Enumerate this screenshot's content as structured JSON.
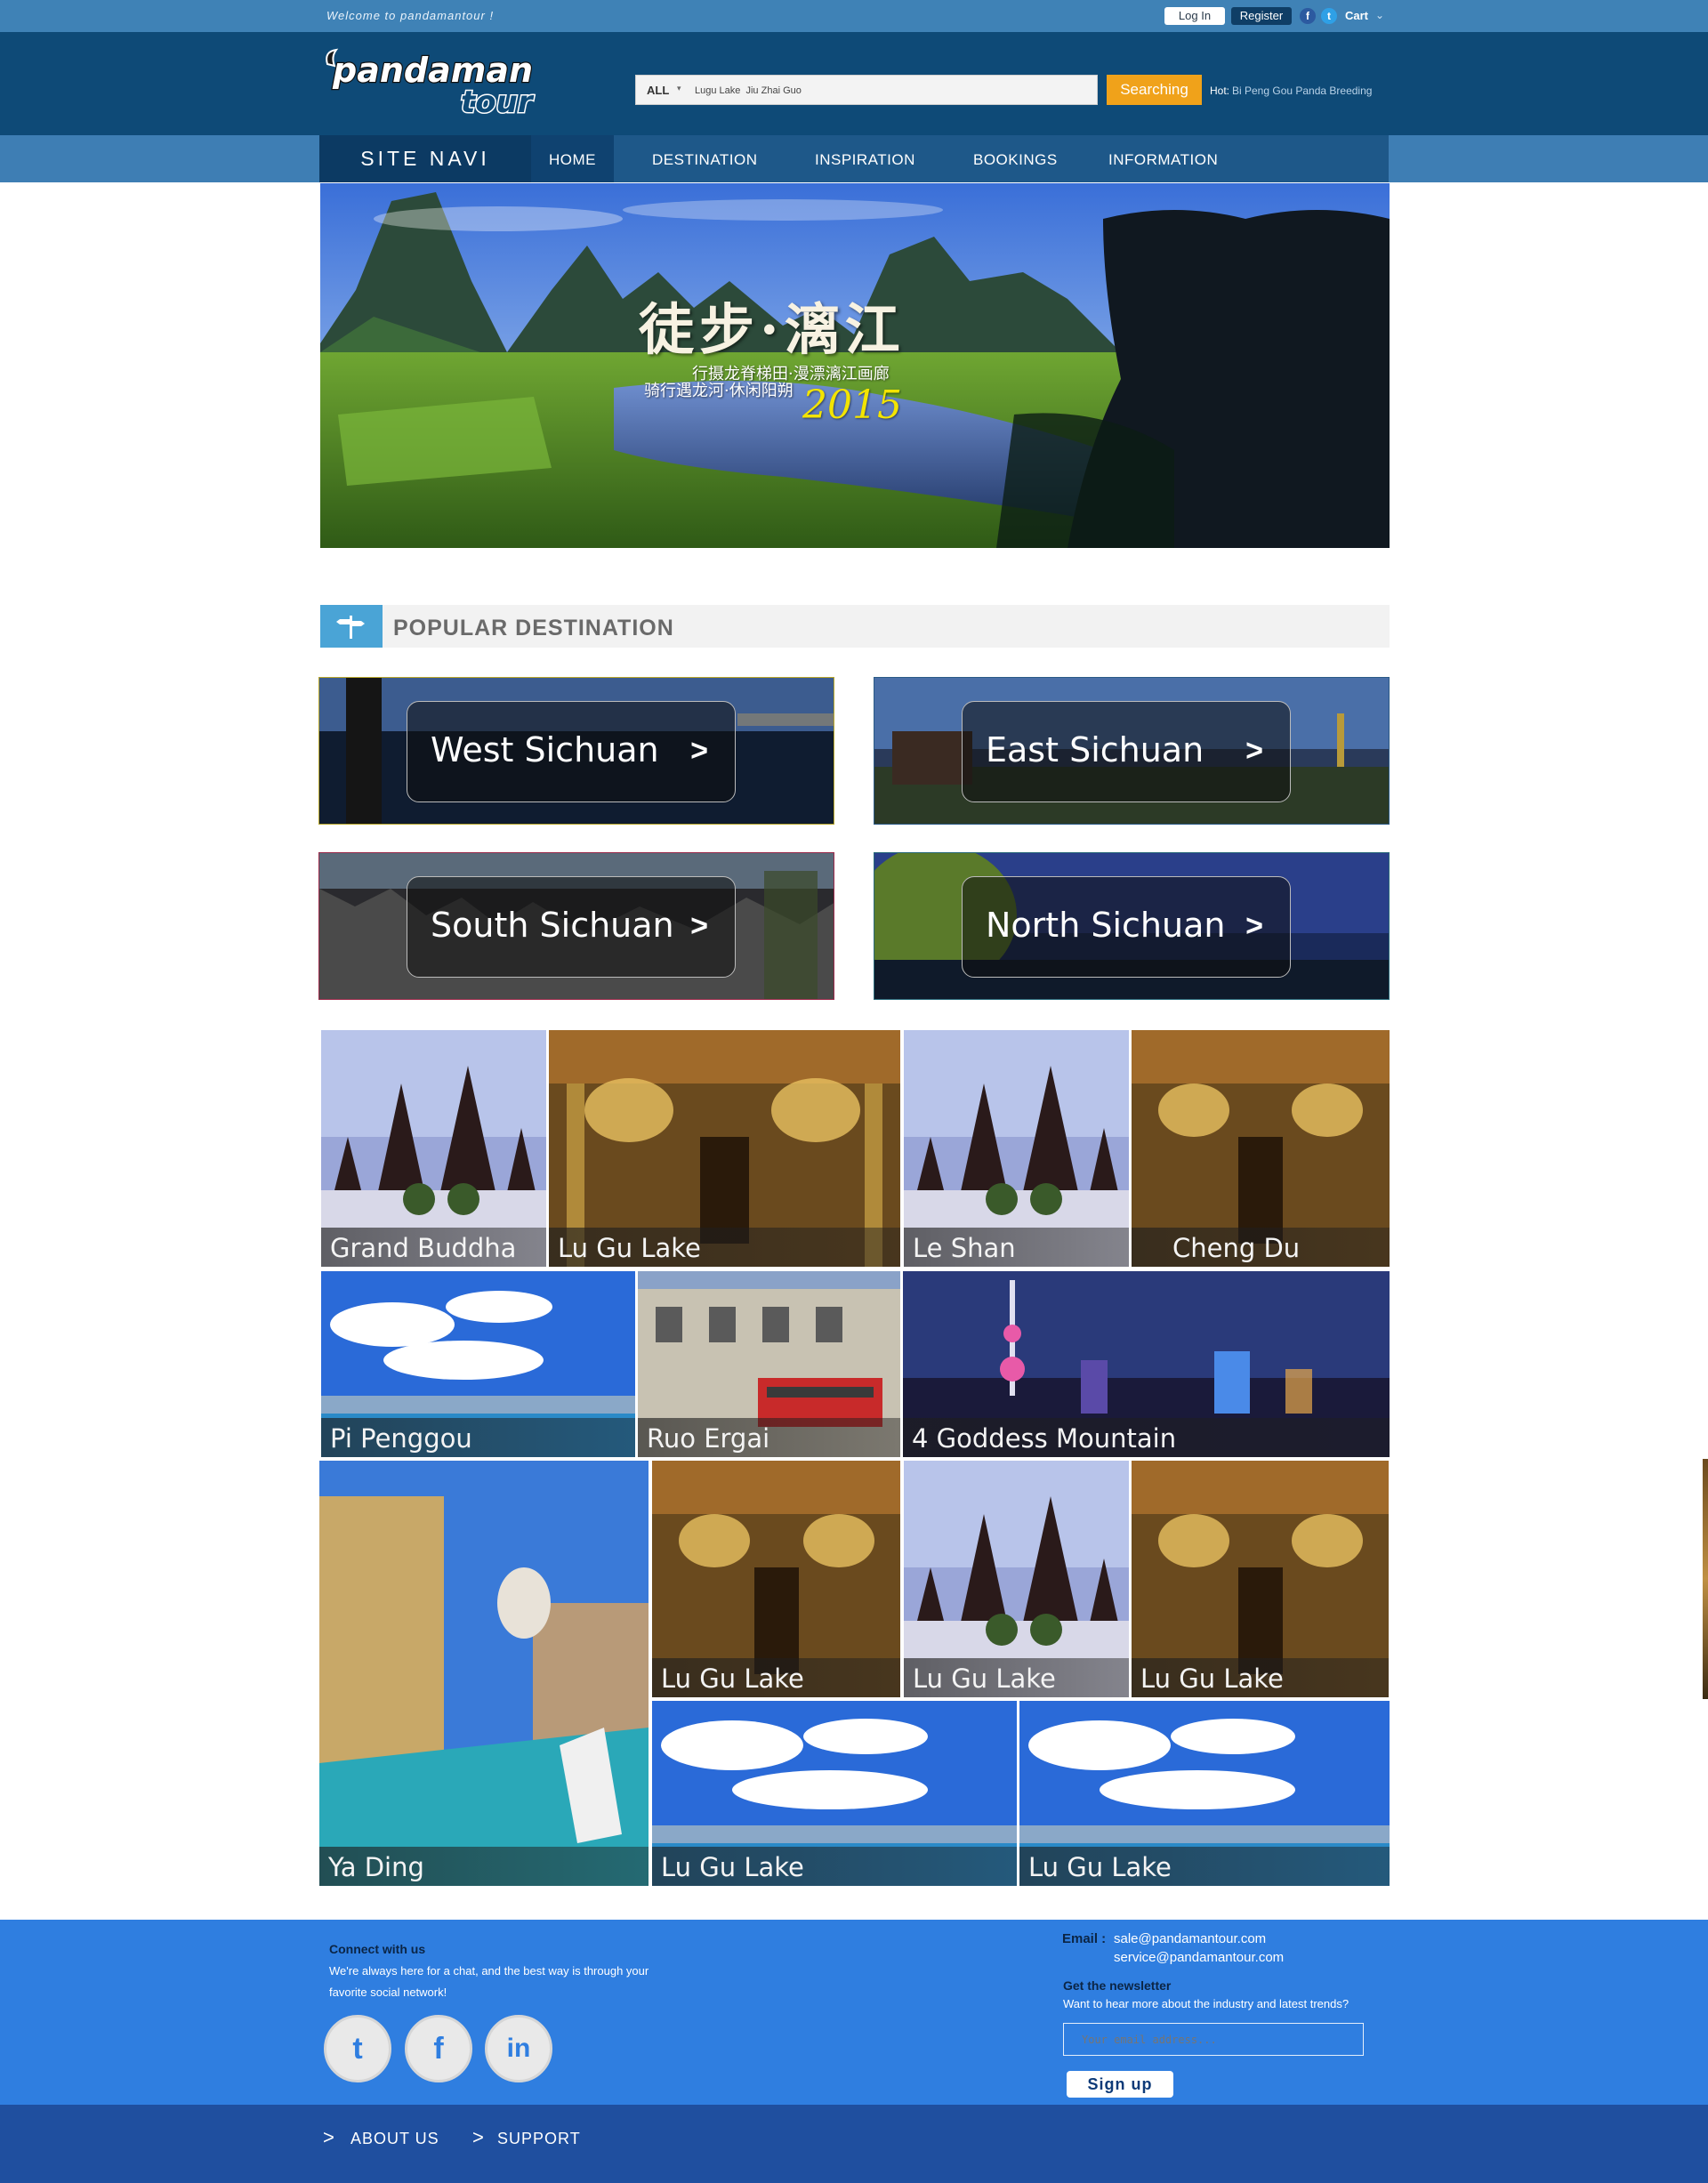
{
  "topbar": {
    "welcome": "Welcome  to  pandamantour !",
    "login": "Log In",
    "register": "Register",
    "facebook_glyph": "f",
    "twitter_glyph": "t",
    "cart": "Cart",
    "cart_chevron": "⌄"
  },
  "header": {
    "logo_line1": "pandaman",
    "logo_line2": "tour",
    "search": {
      "category": "ALL",
      "category_chevron": "▾",
      "value": "Lugu Lake  Jiu Zhai Guo",
      "button": "Searching"
    },
    "hot_label": "Hot:",
    "hot_links": "Bi Peng Gou  Panda Breeding"
  },
  "nav": {
    "site_navi": "SITE NAVI",
    "items": [
      "HOME",
      "DESTINATION",
      "INSPIRATION",
      "BOOKINGS",
      "INFORMATION"
    ]
  },
  "hero": {
    "title": "徒步·漓江",
    "subtitle1": "行摄龙脊梯田·漫漂漓江画廊",
    "subtitle2": "骑行遇龙河·休闲阳朔",
    "year": "2015"
  },
  "popular": {
    "title": "POPULAR DESTINATION",
    "regions": [
      {
        "name": "West Sichuan",
        "arrow": ">"
      },
      {
        "name": "East Sichuan",
        "arrow": ">"
      },
      {
        "name": "South Sichuan",
        "arrow": ">"
      },
      {
        "name": "North Sichuan",
        "arrow": ">"
      }
    ]
  },
  "gallery": {
    "tiles": [
      "Grand Buddha",
      "Lu Gu Lake",
      "Le Shan",
      "Cheng Du",
      "Pi Penggou",
      "Ruo Ergai",
      "4 Goddess Mountain",
      "Ya Ding",
      "Lu Gu Lake",
      "Lu Gu Lake",
      "Lu Gu Lake",
      "Lu Gu Lake",
      "Lu Gu Lake"
    ]
  },
  "footer": {
    "connect_title": "Connect with us",
    "connect_text": "We're always here for a chat, and the best way is through your  favorite social network!",
    "social_glyphs": [
      "t",
      "f",
      "in"
    ],
    "email_label": "Email :",
    "email1": "sale@pandamantour.com",
    "email2": "service@pandamantour.com",
    "newsletter_title": "Get the newsletter",
    "newsletter_text": "Want to hear more about the industry and latest trends?",
    "email_placeholder": "Your email address...",
    "signup": "Sign  up"
  },
  "bottom": {
    "chevron": ">",
    "links": [
      "ABOUT   US",
      "SUPPORT"
    ]
  },
  "colors": {
    "topbar": "#3f82b6",
    "header": "#0e4a77",
    "nav": "#1e5889",
    "accent_orange": "#f0a21a",
    "footer": "#2f7ee0",
    "bottombar": "#1f4f9f"
  }
}
